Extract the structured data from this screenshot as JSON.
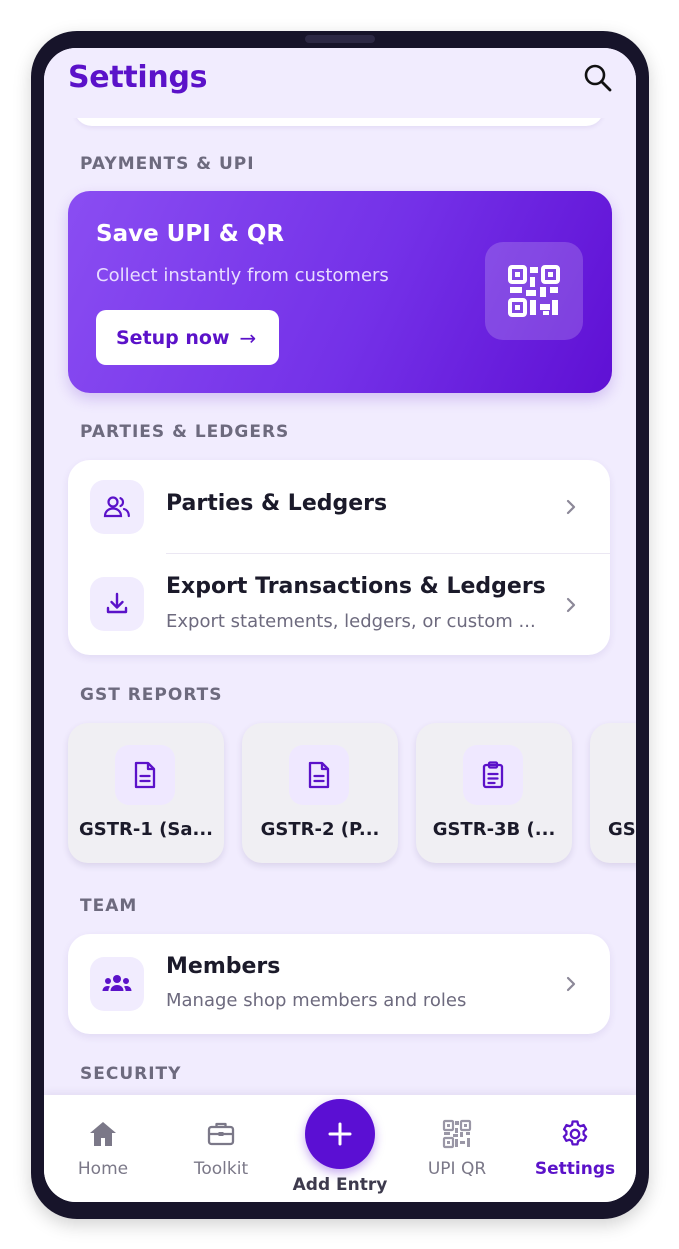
{
  "header": {
    "title": "Settings"
  },
  "sections": {
    "payments": "PAYMENTS & UPI",
    "parties": "PARTIES & LEDGERS",
    "gst": "GST REPORTS",
    "team": "TEAM",
    "security": "SECURITY"
  },
  "upi_banner": {
    "title": "Save UPI & QR",
    "subtitle": "Collect instantly from customers",
    "button_label": "Setup now",
    "button_arrow": "→"
  },
  "parties_card": {
    "items": [
      {
        "title": "Parties & Ledgers",
        "icon": "users-icon"
      },
      {
        "title": "Export Transactions & Ledgers",
        "subtitle": "Export statements, ledgers, or custom ...",
        "icon": "download-icon"
      }
    ]
  },
  "gst_reports": [
    {
      "label": "GSTR-1 (Sa...",
      "icon": "document-icon"
    },
    {
      "label": "GSTR-2 (P...",
      "icon": "document-icon"
    },
    {
      "label": "GSTR-3B (...",
      "icon": "clipboard-icon"
    },
    {
      "label": "GS",
      "icon": "document-icon"
    }
  ],
  "team_card": {
    "title": "Members",
    "subtitle": "Manage shop members and roles",
    "icon": "team-icon"
  },
  "bottom_nav": {
    "items": [
      {
        "label": "Home",
        "icon": "home-icon"
      },
      {
        "label": "Toolkit",
        "icon": "briefcase-icon"
      },
      {
        "label": "UPI QR",
        "icon": "qr-icon"
      },
      {
        "label": "Settings",
        "icon": "gear-icon",
        "active": true
      }
    ],
    "add_entry_label": "Add Entry"
  },
  "colors": {
    "brand": "#5b12c9",
    "background": "#f1ecfe",
    "banner_start": "#8a4df2",
    "banner_end": "#5f10d4"
  }
}
